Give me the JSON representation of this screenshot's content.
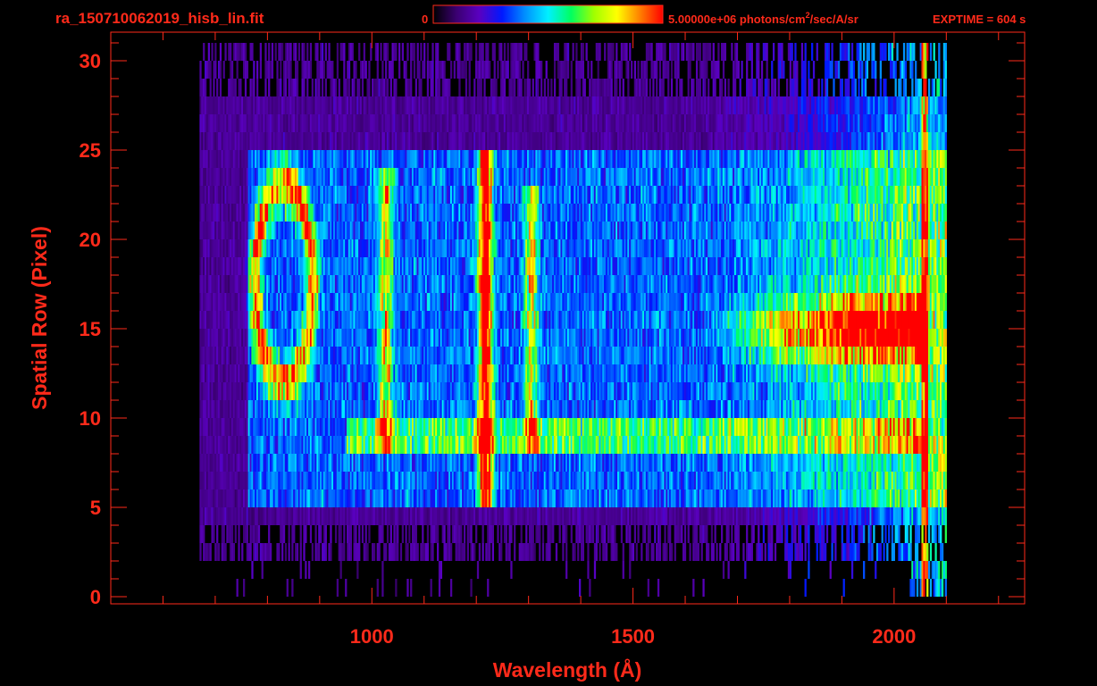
{
  "filename": "ra_150710062019_hisb_lin.fit",
  "colorbar": {
    "min_label": "0",
    "max_label": "5.00000e+06 photons/cm",
    "unit_sup": "2",
    "unit_tail": "/sec/A/sr",
    "colors": [
      "#000000",
      "#3a0070",
      "#5a00c0",
      "#0018ff",
      "#0090ff",
      "#00f0ff",
      "#00ff60",
      "#a0ff00",
      "#ffff00",
      "#ff8000",
      "#ff0000"
    ]
  },
  "exptime": "EXPTIME = 604 s",
  "axis_color": "#ff2a1a",
  "chart_data": {
    "type": "heatmap",
    "title": "",
    "xlabel": "Wavelength (Å)",
    "ylabel": "Spatial Row (Pixel)",
    "xlim": [
      500,
      2250
    ],
    "ylim": [
      -0.4,
      31.6
    ],
    "x_major_ticks": [
      1000,
      1500,
      2000
    ],
    "x_minor_ticks": [
      600,
      700,
      800,
      900,
      1100,
      1200,
      1300,
      1400,
      1600,
      1700,
      1800,
      1900,
      2100,
      2200
    ],
    "y_major_ticks": [
      0,
      5,
      10,
      15,
      20,
      25,
      30
    ],
    "y_minor_ticks": [
      1,
      2,
      3,
      4,
      6,
      7,
      8,
      9,
      11,
      12,
      13,
      14,
      16,
      17,
      18,
      19,
      21,
      22,
      23,
      24,
      26,
      27,
      28,
      29,
      31
    ],
    "color_scale": "linear",
    "value_range": [
      0,
      5000000
    ],
    "data_extent": {
      "wavelength": [
        670,
        2100
      ],
      "row": [
        0,
        31
      ]
    },
    "features": [
      {
        "name": "Lyman-alpha line",
        "wavelength": 1216,
        "rows": [
          5,
          24
        ],
        "level": 0.85
      },
      {
        "name": "line",
        "wavelength": 1025,
        "rows": [
          8,
          23
        ],
        "level": 0.45
      },
      {
        "name": "line",
        "wavelength": 1304,
        "rows": [
          8,
          22
        ],
        "level": 0.4
      },
      {
        "name": "ring feature",
        "wavelength_center": 830,
        "row_center": 17,
        "level": 0.55
      },
      {
        "name": "continuum band",
        "wavelength": [
          1700,
          2060
        ],
        "rows": [
          13,
          16
        ],
        "level": 0.7
      }
    ]
  }
}
